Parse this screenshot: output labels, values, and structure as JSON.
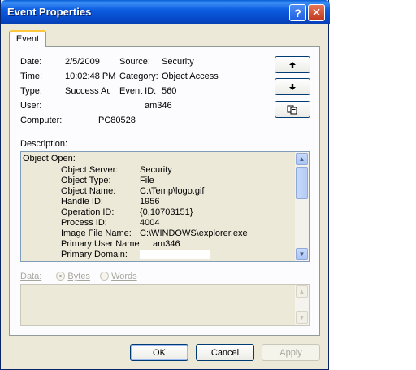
{
  "window": {
    "title": "Event Properties"
  },
  "titlebar": {
    "help_glyph": "?",
    "close_glyph": "✕"
  },
  "tabs": [
    {
      "label": "Event"
    }
  ],
  "event": {
    "date_label": "Date:",
    "date": "2/5/2009",
    "source_label": "Source:",
    "source": "Security",
    "time_label": "Time:",
    "time": "10:02:48 PM",
    "category_label": "Category:",
    "category": "Object Access",
    "type_label": "Type:",
    "type": "Success Au",
    "event_id_label": "Event ID:",
    "event_id": "560",
    "user_label": "User:",
    "user": "am346",
    "computer_label": "Computer:",
    "computer": "PC80528"
  },
  "description": {
    "label": "Description:",
    "heading": "Object Open:",
    "rows": [
      {
        "key": "Object Server:",
        "value": "Security"
      },
      {
        "key": "Object Type:",
        "value": "File"
      },
      {
        "key": "Object Name:",
        "value": "C:\\Temp\\logo.gif"
      },
      {
        "key": "Handle ID:",
        "value": "1956"
      },
      {
        "key": "Operation ID:",
        "value": "{0,10703151}"
      },
      {
        "key": "Process ID:",
        "value": "4004"
      },
      {
        "key": "Image File Name:",
        "value": "C:\\WINDOWS\\explorer.exe"
      },
      {
        "key": "Primary User Name",
        "value": "am346"
      },
      {
        "key": "Primary Domain:",
        "value": ""
      }
    ]
  },
  "data_section": {
    "label": "Data:",
    "bytes_label": "Bytes",
    "words_label": "Words",
    "selected": "Bytes"
  },
  "buttons": {
    "ok": "OK",
    "cancel": "Cancel",
    "apply": "Apply"
  },
  "icons": {
    "up": "arrow-up-icon",
    "down": "arrow-down-icon",
    "copy": "copy-icon"
  },
  "colors": {
    "titlebar": "#0b5ce0",
    "dialog_bg": "#ece9d8",
    "tab_highlight": "#ffc83c",
    "close_button": "#c0391b"
  }
}
